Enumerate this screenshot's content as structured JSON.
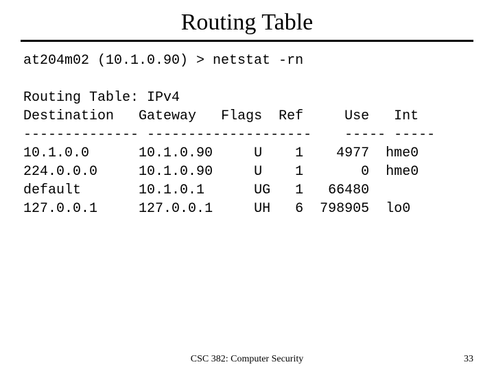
{
  "title": "Routing Table",
  "command": "at204m02 (10.1.0.90) > netstat -rn",
  "heading": "Routing Table: IPv4",
  "columns": {
    "dest": "Destination",
    "gateway": "Gateway",
    "flags": "Flags",
    "ref": "Ref",
    "use": "Use",
    "int": "Int"
  },
  "dashes": {
    "left": "--------------",
    "mid": "--------------------",
    "use": "-----",
    "int": "-----"
  },
  "rows": [
    {
      "dest": "10.1.0.0",
      "gateway": "10.1.0.90",
      "flags": "U",
      "ref": "1",
      "use": "4977",
      "int": "hme0"
    },
    {
      "dest": "224.0.0.0",
      "gateway": "10.1.0.90",
      "flags": "U",
      "ref": "1",
      "use": "0",
      "int": "hme0"
    },
    {
      "dest": "default",
      "gateway": "10.1.0.1",
      "flags": "UG",
      "ref": "1",
      "use": "66480",
      "int": ""
    },
    {
      "dest": "127.0.0.1",
      "gateway": "127.0.0.1",
      "flags": "UH",
      "ref": "6",
      "use": "798905",
      "int": "lo0"
    }
  ],
  "footer": {
    "course": "CSC 382: Computer Security",
    "page": "33"
  }
}
